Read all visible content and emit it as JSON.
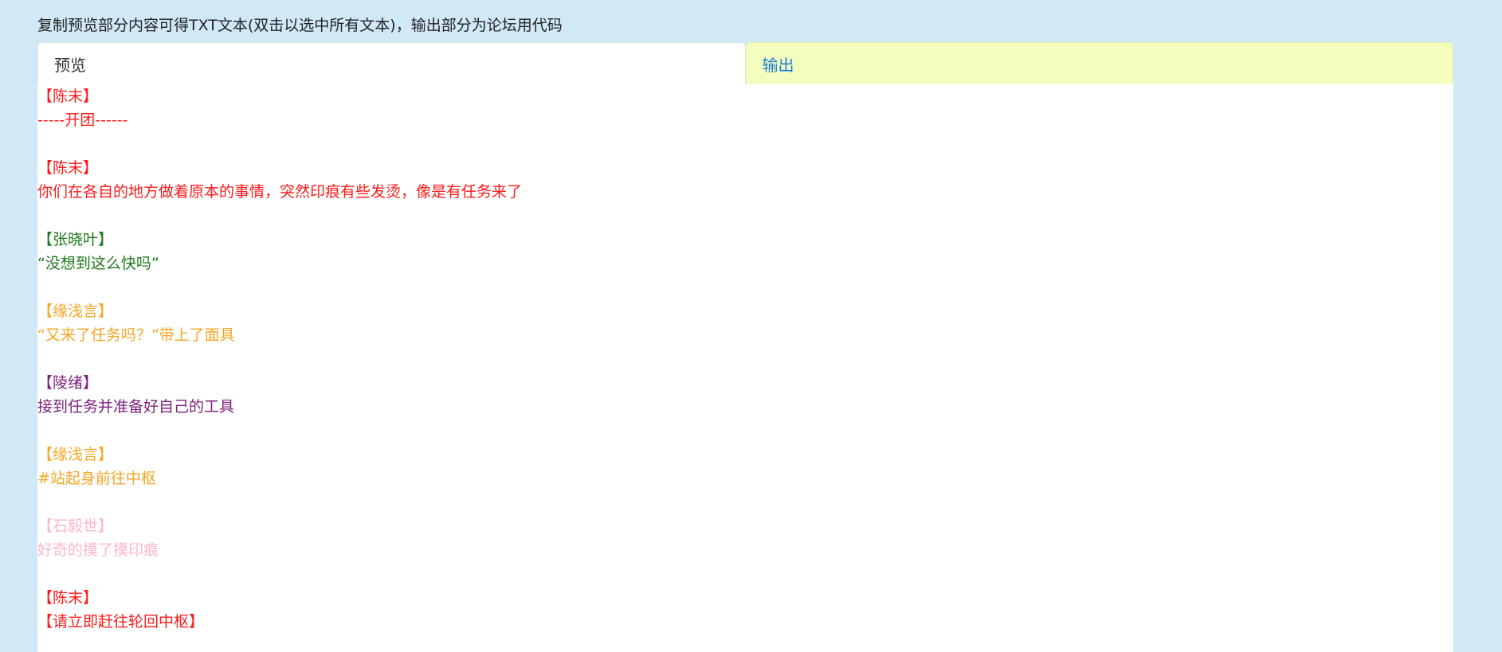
{
  "instruction": "复制预览部分内容可得TXT文本(双击以选中所有文本)，输出部分为论坛用代码",
  "tabs": {
    "preview_label": "预览",
    "output_label": "输出"
  },
  "colors": {
    "background": "#d1e8f6",
    "output_tab": "#f4ffbf",
    "link_blue": "#1f7bd6"
  },
  "log": [
    {
      "speaker": "【陈末】",
      "text": "-----开团------",
      "color": "#ff1a1a"
    },
    {
      "speaker": "【陈末】",
      "text": "你们在各自的地方做着原本的事情，突然印痕有些发烫，像是有任务来了",
      "color": "#ff1a1a"
    },
    {
      "speaker": "【张晓叶】",
      "text": "“没想到这么快吗”",
      "color": "#1e7a1e"
    },
    {
      "speaker": "【缘浅言】",
      "text": "“又来了任务吗？”带上了面具",
      "color": "#f5a623"
    },
    {
      "speaker": "【陵绪】",
      "text": "接到任务并准备好自己的工具",
      "color": "#7a1f7a"
    },
    {
      "speaker": "【缘浅言】",
      "text": "#站起身前往中枢",
      "color": "#f5a623"
    },
    {
      "speaker": "【石毅世】",
      "text": "好奇的摸了摸印痕",
      "color": "#ffb6c8"
    },
    {
      "speaker": "【陈末】",
      "text": "【请立即赶往轮回中枢】",
      "color": "#ff1a1a"
    }
  ]
}
